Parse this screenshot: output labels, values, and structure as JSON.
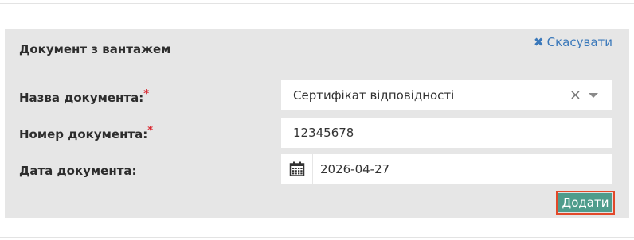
{
  "panel": {
    "title": "Документ з вантажем",
    "cancel_label": "Скасувати"
  },
  "form": {
    "doc_name": {
      "label": "Назва документа:",
      "required_mark": "*",
      "value": "Сертифікат відповідності"
    },
    "doc_number": {
      "label": "Номер документа:",
      "required_mark": "*",
      "value": "12345678"
    },
    "doc_date": {
      "label": "Дата документа:",
      "value": "2026-04-27"
    }
  },
  "actions": {
    "add_label": "Додати"
  },
  "colors": {
    "panel_bg": "#e6e6e6",
    "link": "#3a78ba",
    "required": "#d9262f",
    "add_button_bg": "#4f9c8c",
    "add_button_focus_border": "#e2492a"
  },
  "icons": {
    "cancel": "close-icon",
    "select_clear": "clear-icon",
    "select_toggle": "chevron-down-icon",
    "date": "calendar-icon"
  }
}
